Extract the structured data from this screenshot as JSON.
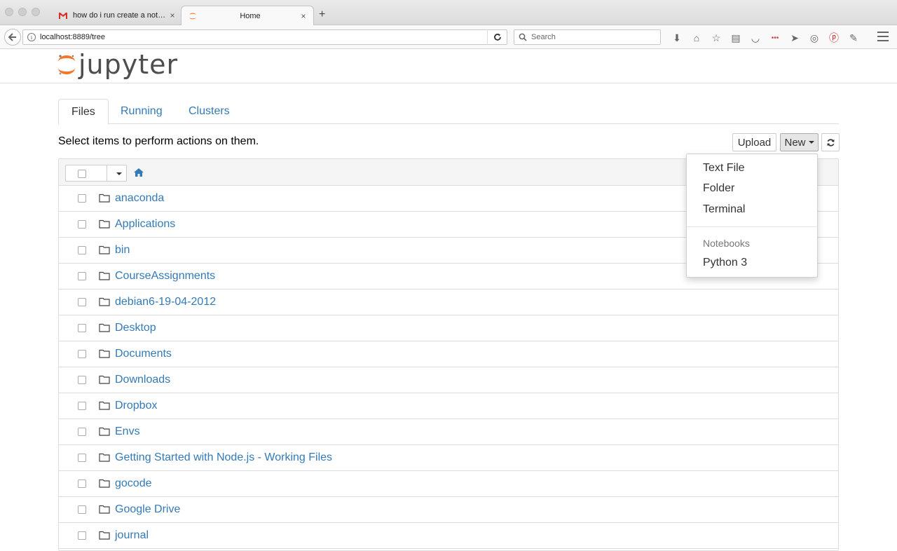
{
  "browser": {
    "tabs": [
      {
        "title": "how do i run create a noteb…",
        "close": "×"
      },
      {
        "title": "Home",
        "close": "×"
      }
    ],
    "new_tab": "+",
    "url": "localhost:8889/tree",
    "search_placeholder": "Search",
    "toolbar_icons": [
      "download-icon",
      "home-icon",
      "bookmark-star-icon",
      "reading-list-icon",
      "pocket-icon",
      "addon-icon",
      "send-icon",
      "extension-icon",
      "pinterest-icon",
      "addon-icon",
      "menu-icon"
    ]
  },
  "jupyter": {
    "logo_text": "jupyter",
    "brand_color": "#F37726"
  },
  "tabs": [
    {
      "label": "Files",
      "active": true
    },
    {
      "label": "Running",
      "active": false
    },
    {
      "label": "Clusters",
      "active": false
    }
  ],
  "hint": "Select items to perform actions on them.",
  "buttons": {
    "upload": "Upload",
    "new": "New"
  },
  "files": [
    "anaconda",
    "Applications",
    "bin",
    "CourseAssignments",
    "debian6-19-04-2012",
    "Desktop",
    "Documents",
    "Downloads",
    "Dropbox",
    "Envs",
    "Getting Started with Node.js - Working Files",
    "gocode",
    "Google Drive",
    "journal"
  ],
  "new_menu": {
    "items": [
      "Text File",
      "Folder",
      "Terminal"
    ],
    "section_header": "Notebooks",
    "notebooks": [
      "Python 3"
    ]
  },
  "colors": {
    "link": "#337ab7",
    "accent": "#F37726"
  }
}
